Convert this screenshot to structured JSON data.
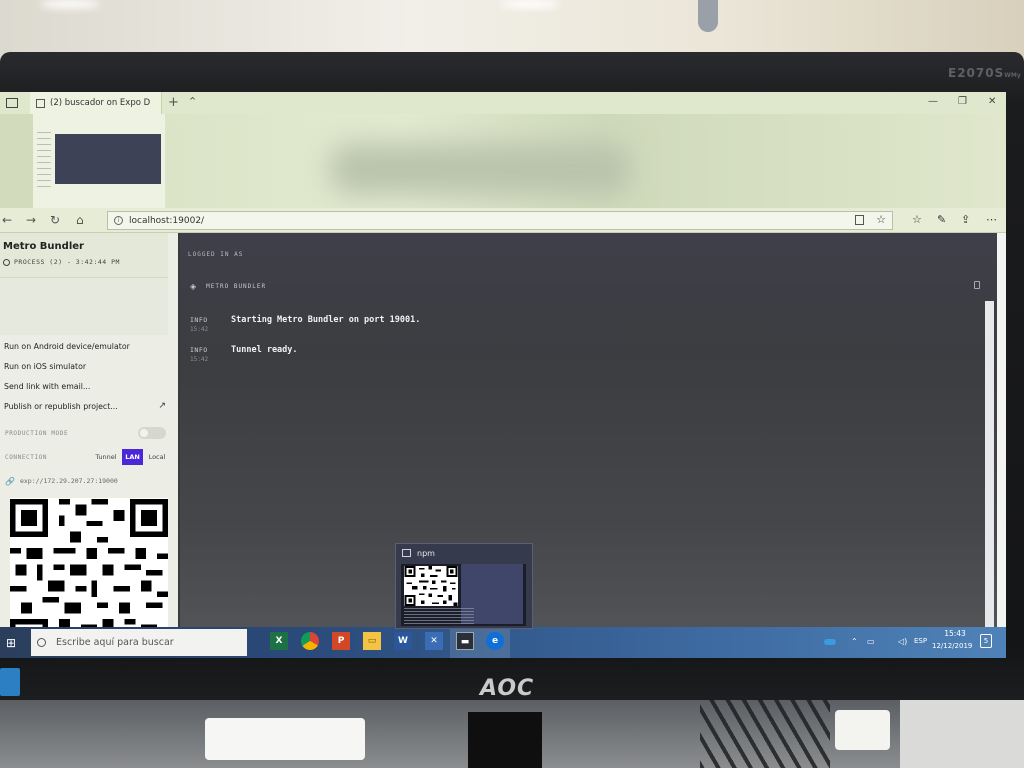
{
  "monitor": {
    "model": "E2070S",
    "model_suffix": "WMy",
    "brand": "AOC"
  },
  "browser": {
    "tab_title": "(2) buscador on Expo D",
    "url": "localhost:19002/"
  },
  "sidebar": {
    "title": "Metro Bundler",
    "process": "PROCESS (2) - 3:42:44 PM",
    "menu": [
      "Run on Android device/emulator",
      "Run on iOS simulator",
      "Send link with email...",
      "Publish or republish project..."
    ],
    "production_label": "PRODUCTION MODE",
    "connection_label": "CONNECTION",
    "connection_options": [
      "Tunnel",
      "LAN",
      "Local"
    ],
    "exp_url": "exp://172.29.207.27:19000"
  },
  "main": {
    "logged_in": "LOGGED IN AS",
    "section_title": "METRO BUNDLER",
    "logs": [
      {
        "level": "INFO",
        "time": "15:42",
        "message": "Starting Metro Bundler on port 19001."
      },
      {
        "level": "INFO",
        "time": "15:42",
        "message": "Tunnel ready."
      }
    ]
  },
  "taskbar": {
    "search_placeholder": "Escribe aquí para buscar",
    "popup_title": "npm",
    "lang": "ESP",
    "time": "15:43",
    "date": "12/12/2019",
    "notifications": "5",
    "apps": [
      "excel-icon",
      "chrome-icon",
      "powerpoint-icon",
      "file-explorer-icon",
      "word-icon",
      "xmind-icon",
      "npm-terminal-icon",
      "edge-icon"
    ]
  },
  "colors": {
    "lan_active": "#4a28d8",
    "taskbar": "#2a4a7a",
    "console_bg": "#3c3d40"
  }
}
